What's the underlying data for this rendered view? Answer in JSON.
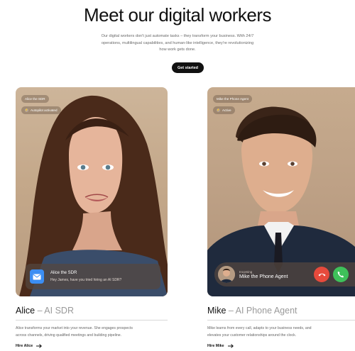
{
  "hero": {
    "title": "Meet our digital workers",
    "subtitle_lines": [
      "Our digital workers don't just automate tasks – they transform your business. With 24/7",
      "operations, multilingual capabilities, and human-like intelligence, they're revolutionizing",
      "how work gets done."
    ],
    "cta_label": "Get started"
  },
  "alice": {
    "chip_name": "Alice the SDR",
    "chip_status": "Autopilot activated",
    "message_title": "Alice the SDR",
    "message_body": "Hey James, have you tried hiring an AI SDR?",
    "name": "Alice",
    "role": " – AI SDR",
    "desc_lines": [
      "Alice transforms your market into your revenue. She engages prospects",
      "across channels, driving qualified meetings and building pipeline."
    ],
    "hire_label": "Hire Alice"
  },
  "mike": {
    "chip_name": "Mike the Phone Agent",
    "chip_status": "Active",
    "call_label": "Incoming",
    "call_name": "Mike the Phone Agent",
    "name": "Mike",
    "role": " – AI Phone Agent",
    "desc_lines": [
      "Mike learns from every call, adapts to your business needs, and",
      "elevates your customer relationships around the clock."
    ],
    "hire_label": "Hire Mike"
  },
  "colors": {
    "accent_mail": "#3b8ef3",
    "decline": "#e64a3c",
    "accept": "#3ec15a",
    "cta_bg": "#111111"
  },
  "icons": [
    "bolt-icon",
    "mail-icon",
    "phone-decline-icon",
    "phone-accept-icon",
    "arrow-right-icon"
  ]
}
